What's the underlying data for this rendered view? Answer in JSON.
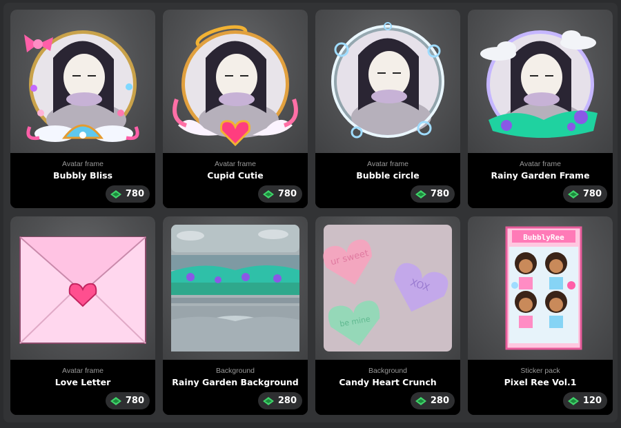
{
  "items": [
    {
      "category": "Avatar frame",
      "name": "Bubbly Bliss",
      "price": "780",
      "thumb": "bubbly-bliss-frame"
    },
    {
      "category": "Avatar frame",
      "name": "Cupid Cutie",
      "price": "780",
      "thumb": "cupid-cutie-frame"
    },
    {
      "category": "Avatar frame",
      "name": "Bubble circle",
      "price": "780",
      "thumb": "bubble-circle-frame"
    },
    {
      "category": "Avatar frame",
      "name": "Rainy Garden Frame",
      "price": "780",
      "thumb": "rainy-garden-frame"
    },
    {
      "category": "Avatar frame",
      "name": "Love Letter",
      "price": "780",
      "thumb": "love-letter-envelope"
    },
    {
      "category": "Background",
      "name": "Rainy Garden Background",
      "price": "280",
      "thumb": "rainy-garden-background"
    },
    {
      "category": "Background",
      "name": "Candy Heart Crunch",
      "price": "280",
      "thumb": "candy-heart-background"
    },
    {
      "category": "Sticker pack",
      "name": "Pixel Ree Vol.1",
      "price": "120",
      "thumb": "pixel-ree-sticker-pack"
    }
  ],
  "candy_hearts": [
    "ur sweet",
    "XOX",
    "be mine"
  ],
  "sticker_pack_label": "BubblyRee",
  "currency_icon": "gem-cash-icon",
  "colors": {
    "price_icon": "#3fd46a",
    "card_bg": "#000000",
    "thumb_bg": "#5a5b5d"
  }
}
